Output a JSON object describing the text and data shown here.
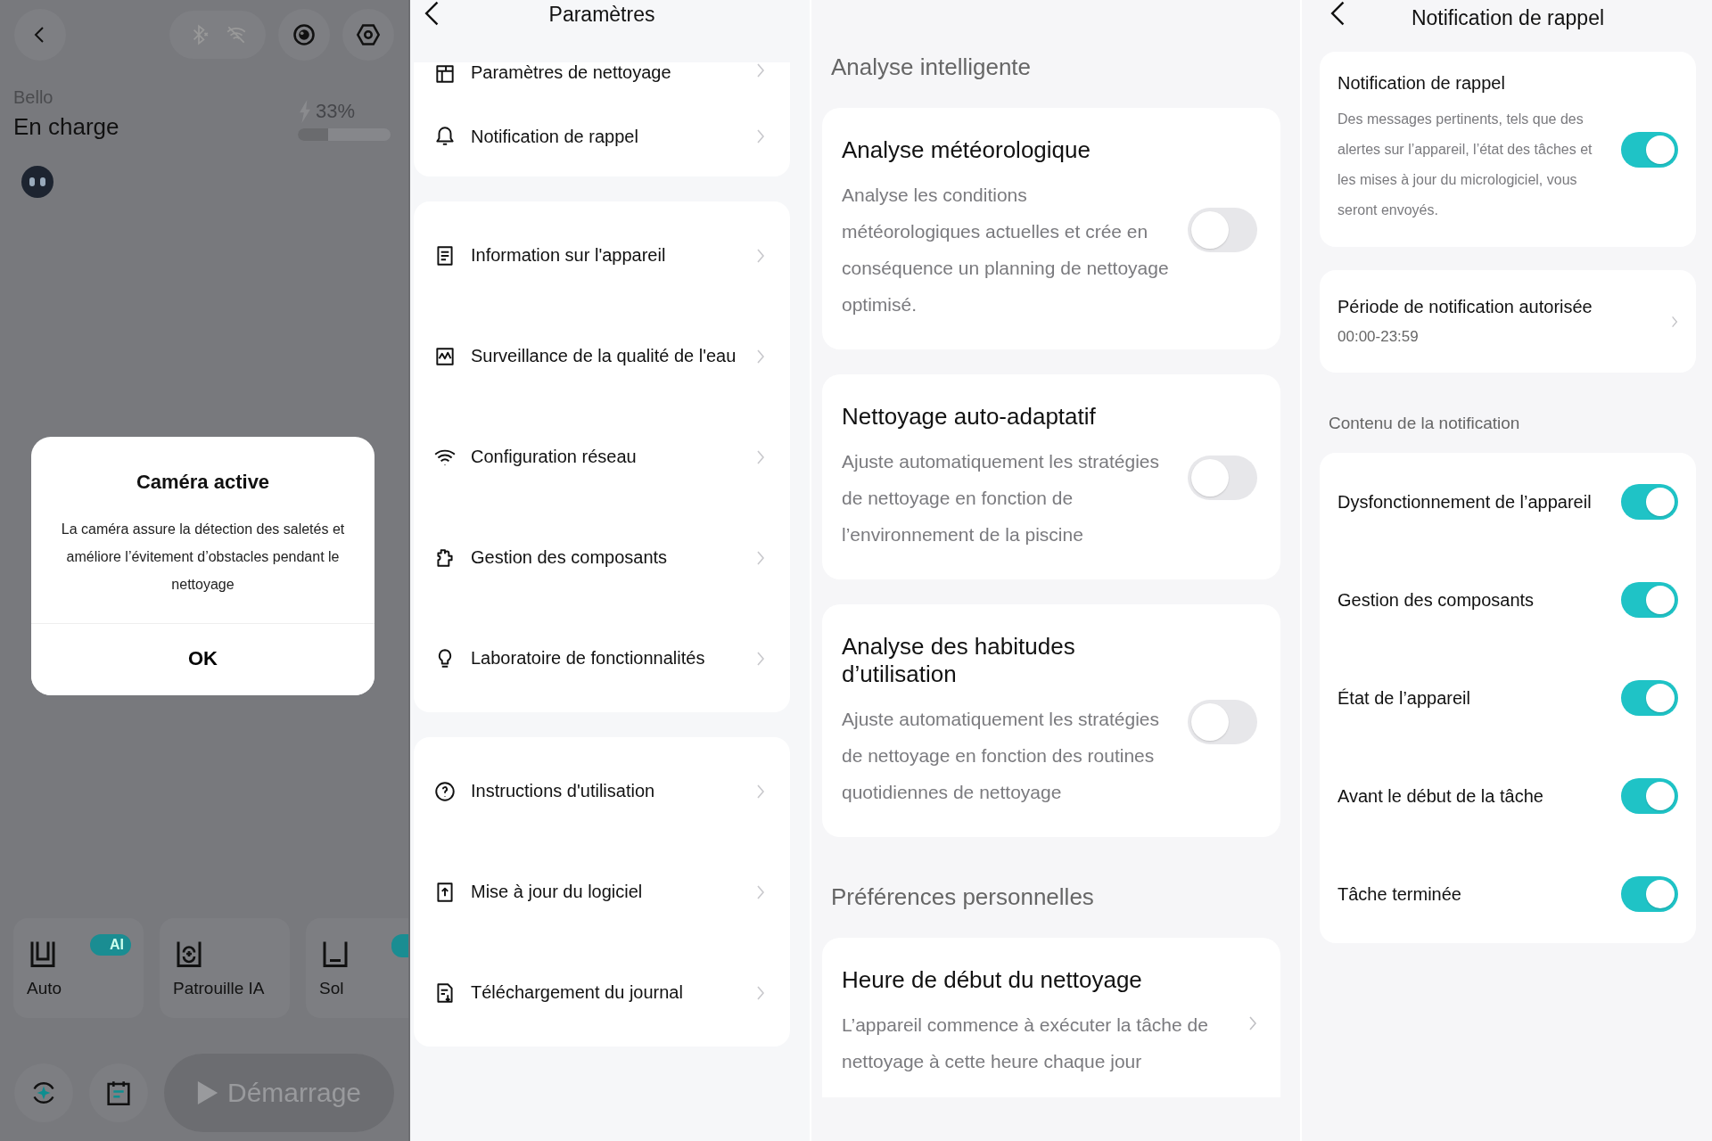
{
  "home": {
    "device_name": "Bello",
    "status": "En charge",
    "battery": {
      "reading": "33%",
      "level": 0.33
    },
    "modes": [
      {
        "label": "Auto",
        "badge": "AI",
        "badge_cut": false
      },
      {
        "label": "Patrouille IA",
        "badge_cut": false
      },
      {
        "label": "Sol",
        "badge_cut": true
      }
    ],
    "start_button": "Démarrage",
    "dialog": {
      "title": "Caméra active",
      "message": "La caméra assure la détection des saletés et améliore l’évitement d’obstacles pendant le nettoyage",
      "ok": "OK"
    }
  },
  "settings": {
    "title": "Paramètres",
    "groups": [
      [
        "Paramètres de nettoyage",
        "Notification de rappel"
      ],
      [
        "Information sur l'appareil",
        "Surveillance de la qualité de l'eau",
        "Configuration réseau",
        "Gestion des composants",
        "Laboratoire de fonctionnalités"
      ],
      [
        "Instructions d'utilisation",
        "Mise à jour du logiciel",
        "Téléchargement du journal"
      ]
    ]
  },
  "smart": {
    "sections": [
      {
        "header": "Analyse intelligente",
        "cards": [
          {
            "kind": "toggle",
            "title": "Analyse météorologique",
            "description": "Analyse les conditions météorologiques actuelles et crée en conséquence un planning de nettoyage optimisé.",
            "on": false
          },
          {
            "kind": "toggle",
            "title": "Nettoyage auto-adaptatif",
            "description": "Ajuste automatiquement les stratégies de nettoyage en fonction de l’environnement de la piscine",
            "on": false
          },
          {
            "kind": "toggle",
            "title": "Analyse des habitudes d’utilisation",
            "description": "Ajuste automatiquement les stratégies de nettoyage en fonction des routines quotidiennes de nettoyage",
            "on": false
          }
        ]
      },
      {
        "header": "Préférences personnelles",
        "cards": [
          {
            "kind": "link",
            "title": "Heure de début du nettoyage",
            "description": "L’appareil commence à exécuter la tâche de nettoyage à cette heure chaque jour"
          }
        ]
      }
    ]
  },
  "reminder": {
    "title": "Notification de rappel",
    "main": {
      "title": "Notification de rappel",
      "description": "Des messages pertinents, tels que des alertes sur l’appareil, l’état des tâches et les mises à jour du micrologiciel, vous seront envoyés.",
      "on": true
    },
    "period": {
      "title": "Période de notification autorisée",
      "value": "00:00-23:59"
    },
    "content_label": "Contenu de la notification",
    "items": [
      {
        "label": "Dysfonctionnement de l’appareil",
        "on": true
      },
      {
        "label": "Gestion des composants",
        "on": true
      },
      {
        "label": "État de l’appareil",
        "on": true
      },
      {
        "label": "Avant le début de la tâche",
        "on": true
      },
      {
        "label": "Tâche terminée",
        "on": true
      }
    ]
  }
}
